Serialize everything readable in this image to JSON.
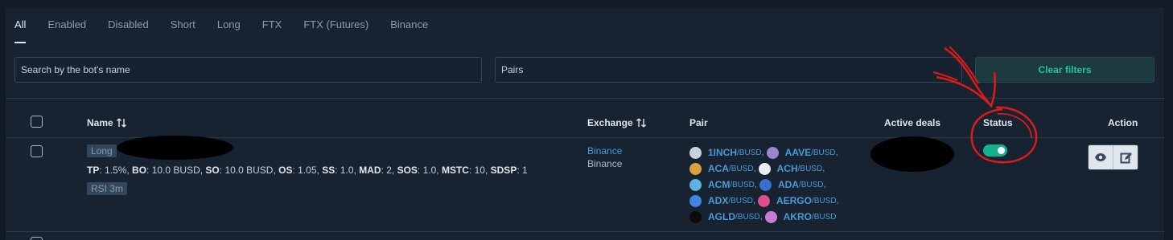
{
  "tabs": [
    "All",
    "Enabled",
    "Disabled",
    "Short",
    "Long",
    "FTX",
    "FTX (Futures)",
    "Binance"
  ],
  "filters": {
    "search_placeholder": "Search by the bot's name",
    "pairs_placeholder": "Pairs",
    "clear_label": "Clear filters"
  },
  "table": {
    "headers": {
      "name": "Name",
      "exchange": "Exchange",
      "pair": "Pair",
      "active_deals": "Active deals",
      "status": "Status",
      "action": "Action"
    },
    "row": {
      "strategy_tag": "Long",
      "params": [
        {
          "key": "TP",
          "value": "1.5%"
        },
        {
          "key": "BO",
          "value": "10.0 BUSD"
        },
        {
          "key": "SO",
          "value": "10.0 BUSD"
        },
        {
          "key": "OS",
          "value": "1.05"
        },
        {
          "key": "SS",
          "value": "1.0"
        },
        {
          "key": "MAD",
          "value": "2"
        },
        {
          "key": "SOS",
          "value": "1.0"
        },
        {
          "key": "MSTC",
          "value": "10"
        },
        {
          "key": "SDSP",
          "value": "1"
        }
      ],
      "indicator_tag": "RSI 3m",
      "exchange_name": "Binance",
      "exchange_account": "Binance",
      "pairs": [
        {
          "symbol": "1INCH",
          "quote": "/BUSD",
          "comma": ",",
          "icon": "1inch-coin-icon",
          "color": "#c9d2dc"
        },
        {
          "symbol": "AAVE",
          "quote": "/BUSD",
          "comma": ",",
          "icon": "aave-coin-icon",
          "color": "#9a86c9"
        },
        {
          "symbol": "ACA",
          "quote": "/BUSD",
          "comma": ",",
          "icon": "aca-coin-icon",
          "color": "#d9a23a"
        },
        {
          "symbol": "ACH",
          "quote": "/BUSD",
          "comma": ",",
          "icon": "ach-coin-icon",
          "color": "#e8edf2"
        },
        {
          "symbol": "ACM",
          "quote": "/BUSD",
          "comma": ",",
          "icon": "acm-coin-icon",
          "color": "#5fb3e0"
        },
        {
          "symbol": "ADA",
          "quote": "/BUSD",
          "comma": ",",
          "icon": "ada-coin-icon",
          "color": "#3a6fd1"
        },
        {
          "symbol": "ADX",
          "quote": "/BUSD",
          "comma": ",",
          "icon": "adx-coin-icon",
          "color": "#3f86e0"
        },
        {
          "symbol": "AERGO",
          "quote": "/BUSD",
          "comma": ",",
          "icon": "aergo-coin-icon",
          "color": "#e04f8c"
        },
        {
          "symbol": "AGLD",
          "quote": "/BUSD",
          "comma": ",",
          "icon": "agld-coin-icon",
          "color": "#0b0b0b"
        },
        {
          "symbol": "AKRO",
          "quote": "/BUSD",
          "comma": "",
          "icon": "akro-coin-icon",
          "color": "#c77dd6"
        }
      ],
      "status_enabled": true
    }
  },
  "colors": {
    "accent": "#1ec6a0",
    "link": "#4a9ad8",
    "annotation": "#e01919"
  }
}
